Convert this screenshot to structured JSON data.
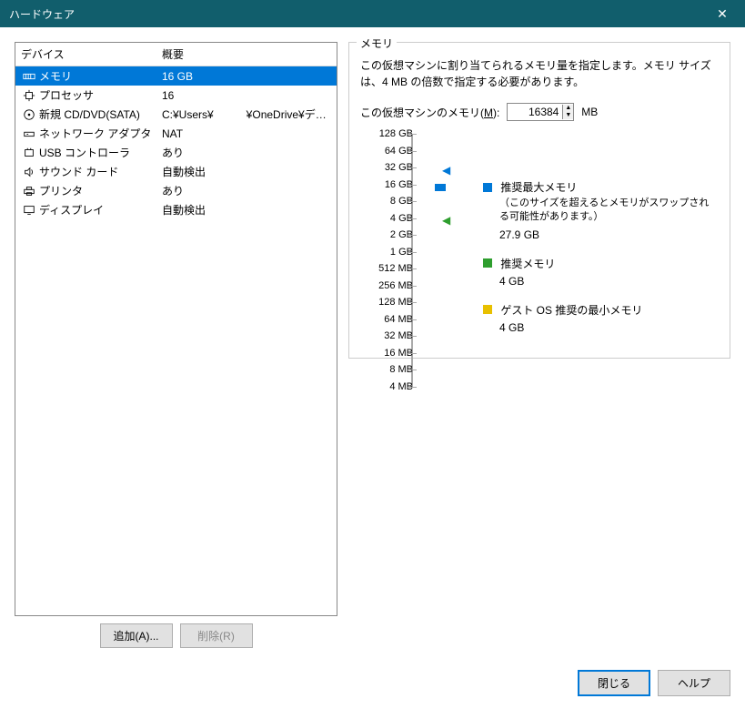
{
  "title": "ハードウェア",
  "columns": {
    "device": "デバイス",
    "summary": "概要"
  },
  "devices": [
    {
      "icon": "memory",
      "name": "メモリ",
      "summary": "16 GB",
      "selected": true
    },
    {
      "icon": "cpu",
      "name": "プロセッサ",
      "summary": "16"
    },
    {
      "icon": "disc",
      "name": "新規 CD/DVD(SATA)",
      "summary": "C:¥Users¥　　　¥OneDrive¥デス..."
    },
    {
      "icon": "network",
      "name": "ネットワーク アダプタ",
      "summary": "NAT"
    },
    {
      "icon": "usb",
      "name": "USB コントローラ",
      "summary": "あり"
    },
    {
      "icon": "sound",
      "name": "サウンド カード",
      "summary": "自動検出"
    },
    {
      "icon": "printer",
      "name": "プリンタ",
      "summary": "あり"
    },
    {
      "icon": "display",
      "name": "ディスプレイ",
      "summary": "自動検出"
    }
  ],
  "buttons": {
    "add": "追加(A)...",
    "remove": "削除(R)",
    "close": "閉じる",
    "help": "ヘルプ"
  },
  "memory": {
    "group_title": "メモリ",
    "description": "この仮想マシンに割り当てられるメモリ量を指定します。メモリ サイズは、4 MB の倍数で指定する必要があります。",
    "input_label_pre": "この仮想マシンのメモリ(",
    "input_label_key": "M",
    "input_label_post": "):",
    "value": "16384",
    "unit": "MB",
    "ticks": [
      "128 GB",
      "64 GB",
      "32 GB",
      "16 GB",
      "8 GB",
      "4 GB",
      "2 GB",
      "1 GB",
      "512 MB",
      "256 MB",
      "128 MB",
      "64 MB",
      "32 MB",
      "16 MB",
      "8 MB",
      "4 MB"
    ],
    "legend": {
      "max": {
        "label": "推奨最大メモリ",
        "sub": "（このサイズを超えるとメモリがスワップされる可能性があります。）",
        "value": "27.9 GB",
        "color": "#0078d7"
      },
      "rec": {
        "label": "推奨メモリ",
        "value": "4 GB",
        "color": "#2e9e2e"
      },
      "min": {
        "label": "ゲスト OS 推奨の最小メモリ",
        "value": "4 GB",
        "color": "#e8c000"
      }
    }
  }
}
